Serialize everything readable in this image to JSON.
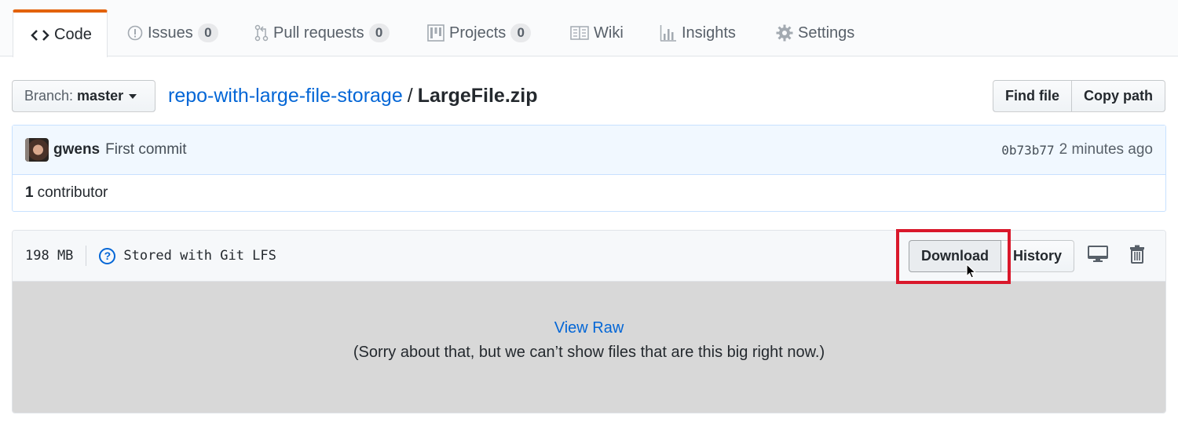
{
  "tabs": [
    {
      "label": "Code",
      "icon": "code-icon",
      "selected": true
    },
    {
      "label": "Issues",
      "icon": "issue-opened-icon",
      "count": "0"
    },
    {
      "label": "Pull requests",
      "icon": "git-pull-request-icon",
      "count": "0"
    },
    {
      "label": "Projects",
      "icon": "project-icon",
      "count": "0"
    },
    {
      "label": "Wiki",
      "icon": "book-icon"
    },
    {
      "label": "Insights",
      "icon": "graph-icon"
    },
    {
      "label": "Settings",
      "icon": "gear-icon"
    }
  ],
  "branch": {
    "prefix": "Branch:",
    "name": "master"
  },
  "breadcrumb": {
    "repo": "repo-with-large-file-storage",
    "separator": "/",
    "file": "LargeFile.zip"
  },
  "path_actions": {
    "find_file": "Find file",
    "copy_path": "Copy path"
  },
  "commit": {
    "author": "gwens",
    "message": "First commit",
    "sha": "0b73b77",
    "time": "2 minutes ago",
    "contributors_count": "1",
    "contributors_label": "contributor"
  },
  "file": {
    "size": "198 MB",
    "lfs_label": "Stored with Git LFS",
    "download_label": "Download",
    "history_label": "History",
    "view_raw_label": "View Raw",
    "too_big_message": "(Sorry about that, but we can’t show files that are this big right now.)"
  },
  "colors": {
    "accent_tab": "#e36209",
    "link": "#0366d6",
    "highlight": "#d9182b"
  }
}
